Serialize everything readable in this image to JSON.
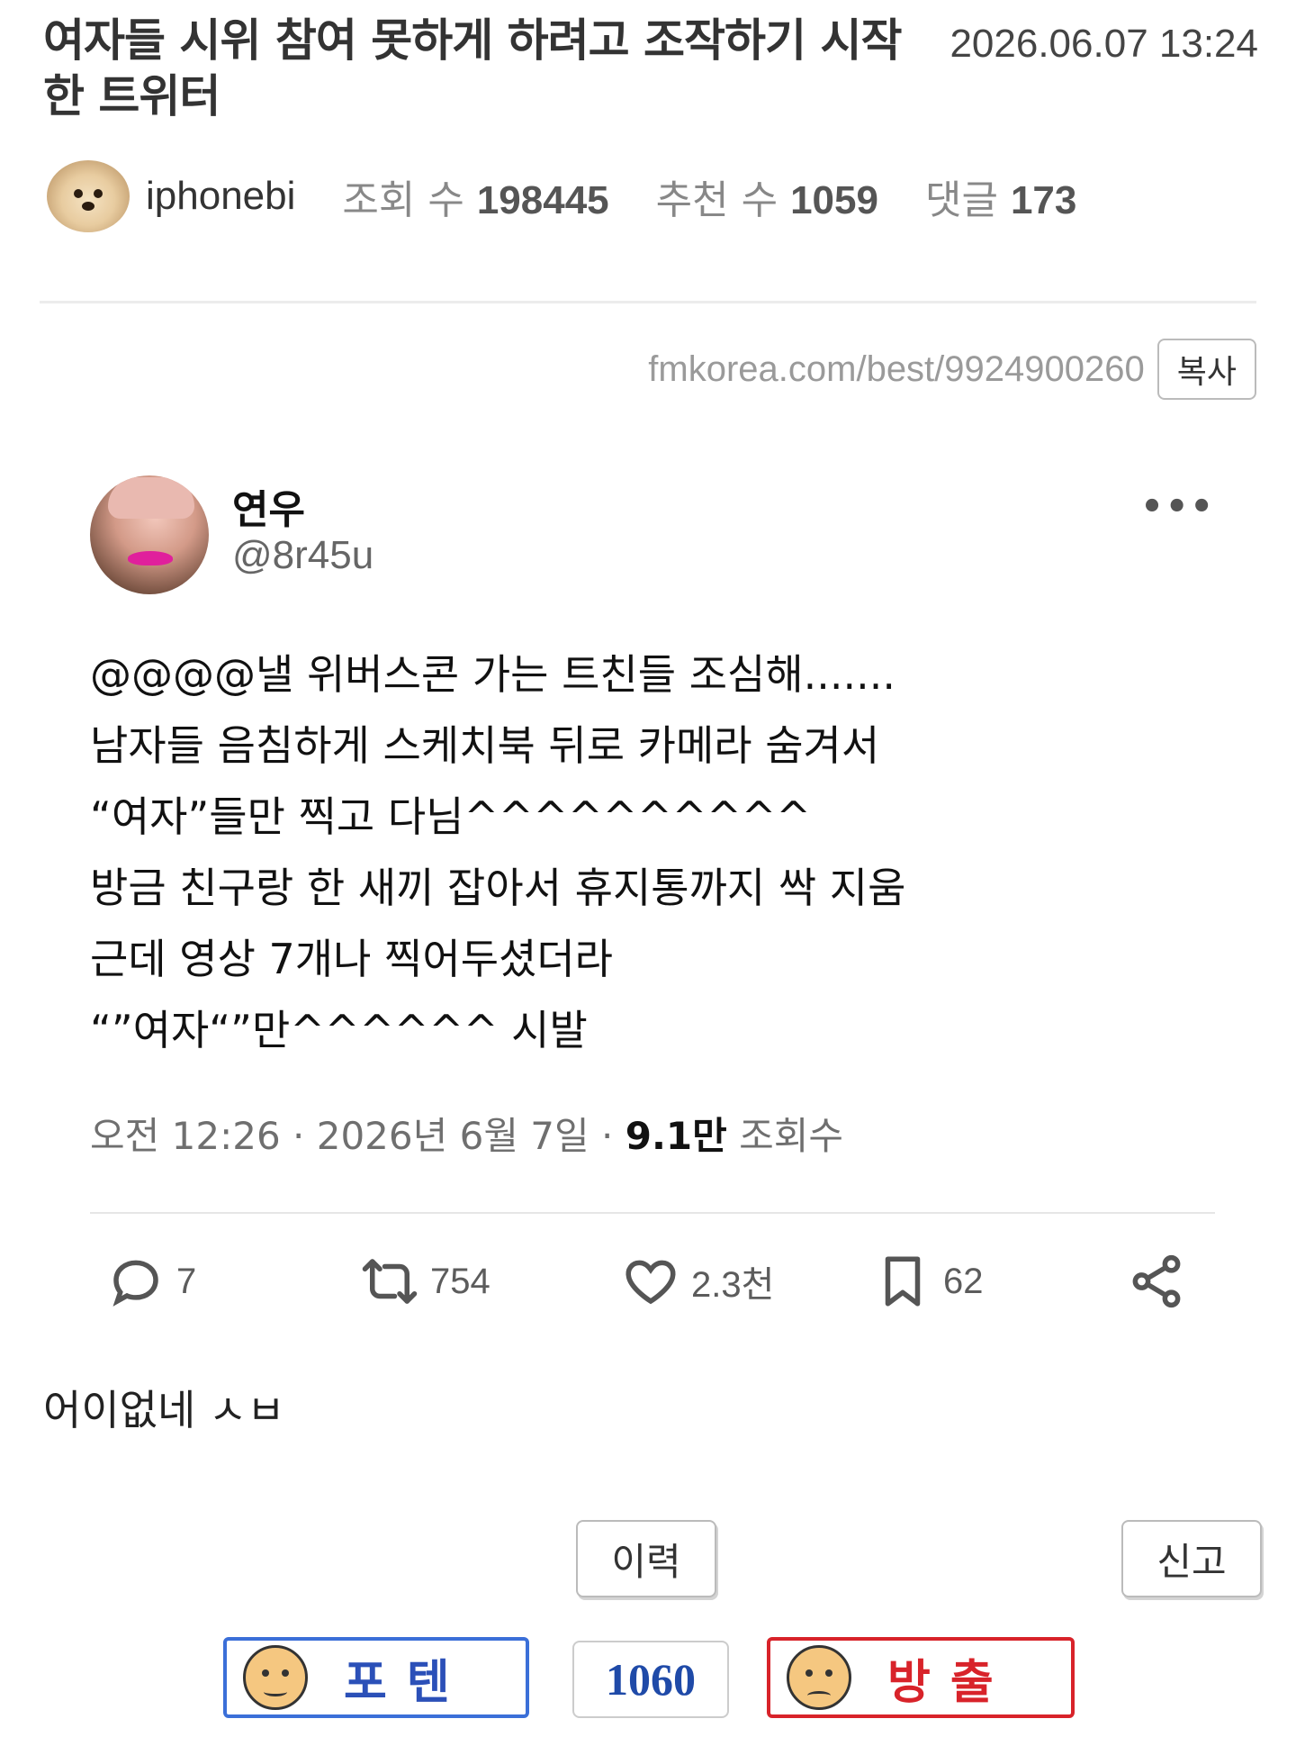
{
  "post": {
    "title": "여자들 시위 참여 못하게 하려고 조작하기 시작한 트위터",
    "datetime": "2026.06.07 13:24",
    "author": "iphonebi",
    "views_label": "조회 수",
    "views": "198445",
    "recommend_label": "추천 수",
    "recommend": "1059",
    "comments_label": "댓글",
    "comments": "173"
  },
  "share": {
    "url": "fmkorea.com/best/9924900260",
    "copy_label": "복사"
  },
  "tweet": {
    "display_name": "연우",
    "handle": "@8r45u",
    "more_icon": "more-icon",
    "lines": [
      "@@@@낼 위버스콘 가는 트친들 조심해.......",
      "남자들 음침하게 스케치북 뒤로 카메라 숨겨서",
      "“여자”들만 찍고 다님^^^^^^^^^^",
      "방금 친구랑 한 새끼 잡아서 휴지통까지 싹 지움",
      "근데 영상 7개나 찍어두셨더라",
      "“”여자“”만^^^^^^ 시발"
    ],
    "time_text": "오전 12:26 · 2026년 6월 7일 · ",
    "view_count": "9.1만",
    "view_label": " 조회수",
    "actions": {
      "reply": "7",
      "retweet": "754",
      "like": "2.3천",
      "bookmark": "62"
    }
  },
  "body_comment": "어이없네 ㅅㅂ",
  "buttons": {
    "history": "이력",
    "report": "신고",
    "upvote": "포텐",
    "upvote_count": "1060",
    "downvote": "방출"
  },
  "colors": {
    "upvote_border": "#3b6fd8",
    "upvote_text": "#2b50b8",
    "downvote_border": "#d8232a",
    "downvote_text": "#d8232a",
    "count_text": "#1f4aa8"
  }
}
